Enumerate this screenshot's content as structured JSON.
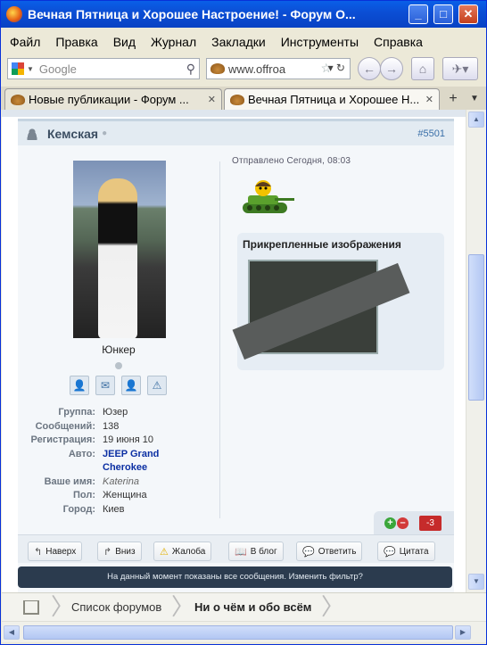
{
  "window": {
    "title": "Вечная Пятница и Хорошее Настроение! - Форум О...",
    "controls": {
      "minimize": "_",
      "maximize": "□",
      "close": "✕"
    }
  },
  "menu": [
    "Файл",
    "Правка",
    "Вид",
    "Журнал",
    "Закладки",
    "Инструменты",
    "Справка"
  ],
  "search": {
    "placeholder": "Google"
  },
  "url": {
    "value": "www.offroa"
  },
  "tabs": [
    {
      "label": "Новые публикации - Форум ...",
      "active": false
    },
    {
      "label": "Вечная Пятница и Хорошее Н...",
      "active": true
    }
  ],
  "post": {
    "author": "Кемская",
    "number": "#5501",
    "sent": "Отправлено Сегодня, 08:03",
    "rank": "Юнкер",
    "profile": [
      {
        "key": "Группа:",
        "value": "Юзер",
        "style": ""
      },
      {
        "key": "Сообщений:",
        "value": "138",
        "style": ""
      },
      {
        "key": "Регистрация:",
        "value": "19 июня 10",
        "style": ""
      },
      {
        "key": "Авто:",
        "value": "JEEP Grand",
        "style": "link"
      },
      {
        "key": "",
        "value": "Cherokee",
        "style": "link"
      },
      {
        "key": "Ваше имя:",
        "value": "Katerina",
        "style": "it"
      },
      {
        "key": "Пол:",
        "value": "Женщина",
        "style": ""
      },
      {
        "key": "Город:",
        "value": "Киев",
        "style": ""
      }
    ],
    "attachments_title": "Прикрепленные изображения",
    "rating": {
      "plus": "+",
      "minus": "–",
      "value": "-3"
    },
    "actions": {
      "up": "Наверх",
      "down": "Вниз",
      "report": "Жалоба",
      "blog": "В блог",
      "reply": "Ответить",
      "quote": "Цитата"
    }
  },
  "notice": "На данный момент показаны все сообщения. Изменить фильтр?",
  "breadcrumbs": {
    "forums": "Список форумов",
    "current": "Ни о чём и обо всём"
  },
  "colors": {
    "accent": "#2b3b4e",
    "link": "#0b2fa3",
    "negative": "#c62b2b"
  }
}
